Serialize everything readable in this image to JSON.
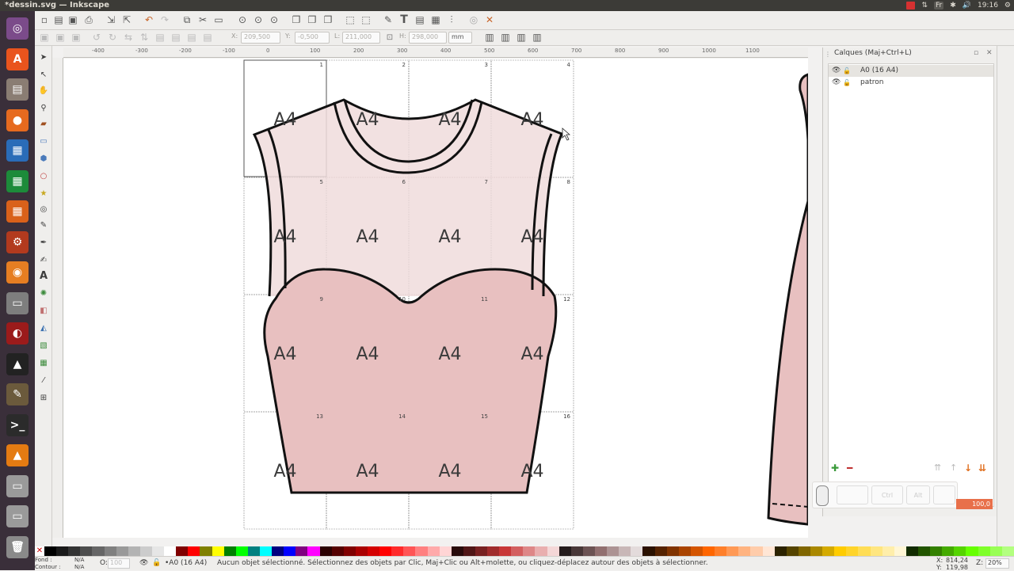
{
  "window": {
    "title": "*dessin.svg — Inkscape"
  },
  "tray": {
    "language": "Fr",
    "time": "19:16"
  },
  "launcher": {
    "items": [
      {
        "name": "ubuntu-dash-icon",
        "bg": "#7b4b8a",
        "glyph": "◎"
      },
      {
        "name": "software-center-icon",
        "bg": "#e9541d",
        "glyph": "A"
      },
      {
        "name": "files-icon",
        "bg": "#8a7d73",
        "glyph": "▤"
      },
      {
        "name": "firefox-icon",
        "bg": "#e66a1f",
        "glyph": "●"
      },
      {
        "name": "libreoffice-writer-icon",
        "bg": "#2a6cb8",
        "glyph": "▦"
      },
      {
        "name": "libreoffice-calc-icon",
        "bg": "#1d8b3a",
        "glyph": "▦"
      },
      {
        "name": "libreoffice-impress-icon",
        "bg": "#d9611a",
        "glyph": "▦"
      },
      {
        "name": "system-settings-icon",
        "bg": "#b23a1e",
        "glyph": "⚙"
      },
      {
        "name": "blender-icon",
        "bg": "#e67e22",
        "glyph": "◉"
      },
      {
        "name": "disks-icon",
        "bg": "#7e7e7e",
        "glyph": "▭"
      },
      {
        "name": "app-red-icon",
        "bg": "#9b1b1b",
        "glyph": "◐"
      },
      {
        "name": "inkscape-icon",
        "bg": "#222222",
        "glyph": "▲"
      },
      {
        "name": "gimp-icon",
        "bg": "#6b5a3c",
        "glyph": "✎"
      },
      {
        "name": "terminal-icon",
        "bg": "#2b2b2b",
        "glyph": ">_"
      },
      {
        "name": "vlc-icon",
        "bg": "#e47b12",
        "glyph": "▲"
      },
      {
        "name": "drive-icon",
        "bg": "#9a9a9a",
        "glyph": "▭"
      },
      {
        "name": "drive-2-icon",
        "bg": "#9a9a9a",
        "glyph": "▭"
      },
      {
        "name": "trash-icon",
        "bg": "#8a8a8a",
        "glyph": "🗑"
      }
    ]
  },
  "controls": {
    "x_label": "X:",
    "x_value": "209,500",
    "y_label": "Y:",
    "y_value": "-0,500",
    "w_label": "L:",
    "w_value": "211,000",
    "h_label": "H:",
    "h_value": "298,000",
    "unit": "mm"
  },
  "ruler": {
    "labels": [
      "-400",
      "-300",
      "-200",
      "-100",
      "0",
      "100",
      "200",
      "300",
      "400",
      "500",
      "600",
      "700",
      "800",
      "900",
      "1000",
      "1100"
    ]
  },
  "canvas": {
    "page_numbers": [
      "1",
      "2",
      "3",
      "4",
      "5",
      "6",
      "7",
      "8",
      "9",
      "10",
      "11",
      "12",
      "13",
      "14",
      "15",
      "16"
    ],
    "tile_label": "A4"
  },
  "layers_panel": {
    "title": "Calques (Maj+Ctrl+L)",
    "layers": [
      {
        "name": "A0 (16 A4)",
        "selected": true
      },
      {
        "name": "patron",
        "selected": false
      }
    ],
    "opacity_value": "100,0",
    "key_hints": [
      "Ctrl",
      "Alt"
    ]
  },
  "status": {
    "fill_label": "Fond :",
    "fill_value": "N/A",
    "stroke_label": "Contour :",
    "stroke_value": "N/A",
    "opacity_label": "O:",
    "opacity_value": "100",
    "current_layer": "•A0 (16 A4)",
    "message": "Aucun objet sélectionné. Sélectionnez des objets par Clic, Maj+Clic ou Alt+molette, ou cliquez-déplacez autour des objets à sélectionner.",
    "x_label": "X:",
    "x_value": "814,24",
    "y_label": "Y:",
    "y_value": "119,98",
    "zoom_label": "Z:",
    "zoom_value": "20%"
  },
  "palette_colors": [
    "#000000",
    "#1a1a1a",
    "#333333",
    "#4d4d4d",
    "#666666",
    "#808080",
    "#999999",
    "#b3b3b3",
    "#cccccc",
    "#e6e6e6",
    "#ffffff",
    "#800000",
    "#ff0000",
    "#808000",
    "#ffff00",
    "#008000",
    "#00ff00",
    "#008080",
    "#00ffff",
    "#000080",
    "#0000ff",
    "#800080",
    "#ff00ff",
    "#2b0000",
    "#550000",
    "#800000",
    "#aa0000",
    "#d40000",
    "#ff0000",
    "#ff2a2a",
    "#ff5555",
    "#ff8080",
    "#ffaaaa",
    "#ffd5d5",
    "#280b0b",
    "#501616",
    "#782121",
    "#a02c2c",
    "#c83737",
    "#d35f5f",
    "#de8787",
    "#e9afaf",
    "#f4d7d7",
    "#241c1c",
    "#483737",
    "#6c5353",
    "#916f6f",
    "#ac9393",
    "#c8b7b7",
    "#e3dbdb",
    "#2b1100",
    "#552200",
    "#803300",
    "#aa4400",
    "#d45500",
    "#ff6600",
    "#ff7f2a",
    "#ff9955",
    "#ffb380",
    "#ffccaa",
    "#ffe6d5",
    "#2b2200",
    "#554400",
    "#806600",
    "#aa8800",
    "#d4aa00",
    "#ffcc00",
    "#ffd42a",
    "#ffdd55",
    "#ffe680",
    "#ffeeaa",
    "#fff6d5",
    "#112b00",
    "#225500",
    "#338000",
    "#44aa00",
    "#55d400",
    "#66ff00",
    "#7fff2a",
    "#99ff55",
    "#b3ff80"
  ]
}
